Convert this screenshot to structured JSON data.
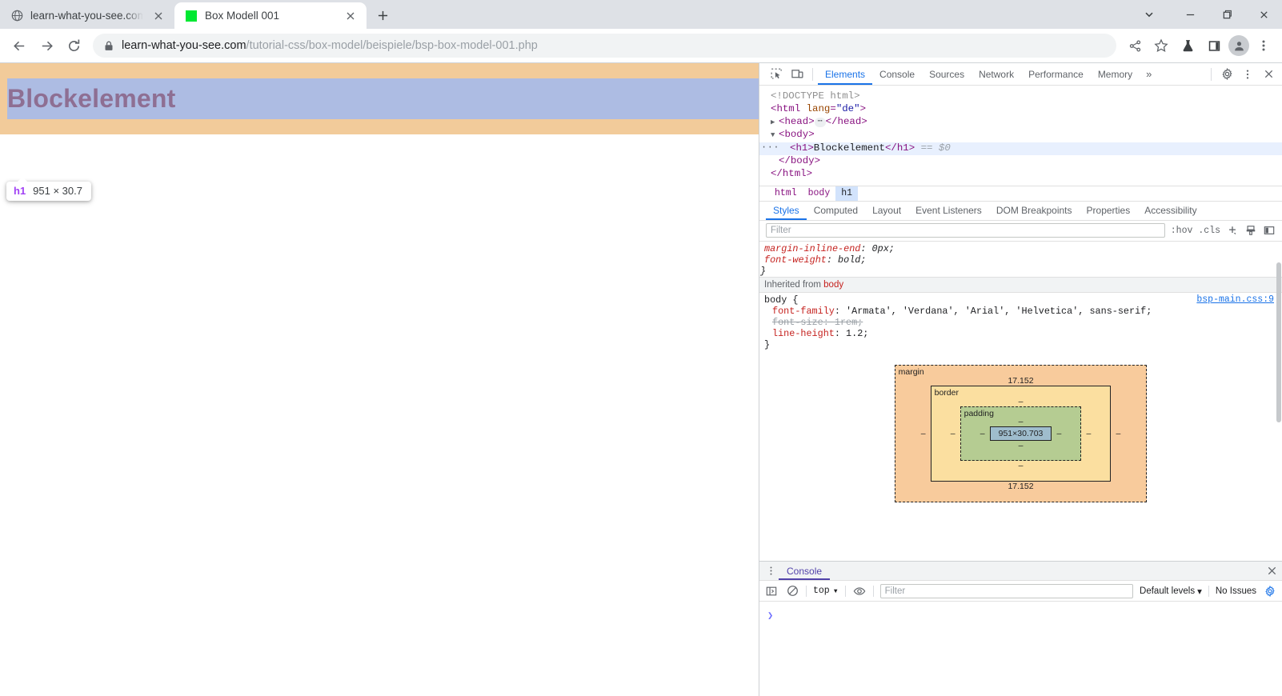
{
  "browser": {
    "tabs": [
      {
        "title": "learn-what-you-see.com -",
        "favicon": "globe-icon",
        "active": false
      },
      {
        "title": "Box Modell 001",
        "favicon": "green-square-icon",
        "active": true
      }
    ],
    "new_tab_label": "+",
    "window_controls": {
      "chevron": "⌄",
      "minimize": "—",
      "maximize": "❐",
      "close": "✕"
    },
    "nav": {
      "back": "←",
      "forward": "→",
      "reload": "⟳"
    },
    "omnibox": {
      "lock_icon": "lock-icon",
      "host": "learn-what-you-see.com",
      "path": "/tutorial-css/box-model/beispiele/bsp-box-model-001.php"
    },
    "toolbar_right": [
      "share-icon",
      "bookmark-star-icon",
      "flask-icon",
      "side-panel-icon",
      "profile-avatar-icon"
    ]
  },
  "page": {
    "heading": "Blockelement",
    "margin_color": "#f2cb9a",
    "heading_bg": "#adbce3",
    "heading_color": "#8e6f93",
    "tooltip": {
      "tag": "h1",
      "dimensions": "951 × 30.7"
    }
  },
  "devtools": {
    "toolbar_icons": [
      "inspect-element-icon",
      "device-toolbar-icon"
    ],
    "panels": [
      "Elements",
      "Console",
      "Sources",
      "Network",
      "Performance",
      "Memory"
    ],
    "panels_selected": "Elements",
    "more_panels_label": "»",
    "settings_icon": "gear-icon",
    "kebab_icon": "more-vertical-icon",
    "close_icon": "close-icon",
    "dom": {
      "lines": [
        {
          "indent": 0,
          "html_doctype": "<!DOCTYPE html>"
        },
        {
          "indent": 0,
          "text": "<html lang=\"de\">"
        },
        {
          "indent": 0,
          "text": "<head>…</head>"
        },
        {
          "indent": 0,
          "text": "<body>"
        },
        {
          "indent": 1,
          "text": "<h1>Blockelement</h1> == $0"
        },
        {
          "indent": 0,
          "text": "</body>"
        },
        {
          "indent": 0,
          "text": "</html>"
        }
      ],
      "doctype": "<!DOCTYPE html>",
      "html_open_tag": "html",
      "html_attr_name": "lang",
      "html_attr_value": "\"de\"",
      "head_tag": "head",
      "body_tag": "body",
      "h1_tag": "h1",
      "h1_text": "Blockelement",
      "selected_marker": "== $0",
      "close_body": "</body>",
      "close_html": "</html>",
      "gutter_dots": "···"
    },
    "breadcrumbs": [
      {
        "label": "html",
        "selected": false
      },
      {
        "label": "body",
        "selected": false
      },
      {
        "label": "h1",
        "selected": true
      }
    ],
    "sidebar_tabs": [
      "Styles",
      "Computed",
      "Layout",
      "Event Listeners",
      "DOM Breakpoints",
      "Properties",
      "Accessibility"
    ],
    "sidebar_tab_selected": "Styles",
    "filter": {
      "placeholder": "Filter",
      "value": ""
    },
    "filter_actions": {
      "hov": ":hov",
      "cls": ".cls",
      "plus": "+",
      "new_style_rule_icon": "new-style-rule-icon",
      "toggle_icon": "toggle-sidebar-icon"
    },
    "styles": {
      "partial_rule": [
        {
          "name": "margin-inline-end",
          "value": "0px;",
          "struck": false
        },
        {
          "name": "font-weight",
          "value": "bold;",
          "struck": false
        }
      ],
      "partial_close": "}",
      "inherited_label": "Inherited from",
      "inherited_from": "body",
      "rule_selector": "body {",
      "rule_source": "bsp-main.css:9",
      "rule_close": "}",
      "declarations": [
        {
          "name": "font-family",
          "value": "'Armata', 'Verdana', 'Arial', 'Helvetica', sans-serif;",
          "struck": false
        },
        {
          "name": "font-size",
          "value": "1rem;",
          "struck": true
        },
        {
          "name": "line-height",
          "value": "1.2;",
          "struck": false
        }
      ]
    },
    "box_model": {
      "margin_label": "margin",
      "border_label": "border",
      "padding_label": "padding",
      "content_size": "951×30.703",
      "margin_top": "17.152",
      "margin_bottom": "17.152",
      "margin_left": "–",
      "margin_right": "–",
      "border_top": "–",
      "border_bottom": "–",
      "border_left": "–",
      "border_right": "–",
      "padding_top": "–",
      "padding_bottom": "–",
      "padding_left": "–",
      "padding_right": "–",
      "colors": {
        "margin": "#f8cb9c",
        "border": "#fbdfa0",
        "padding": "#b5cc92",
        "content": "#9fbdcd"
      }
    },
    "drawer": {
      "kebab_icon": "more-vertical-icon",
      "tab_label": "Console",
      "close_icon": "close-icon",
      "toolbar": {
        "sidebar_icon": "console-sidebar-icon",
        "clear_icon": "clear-console-icon",
        "context": "top",
        "context_caret": "▾",
        "eye_icon": "live-expression-icon",
        "filter_placeholder": "Filter",
        "levels": "Default levels",
        "levels_caret": "▾",
        "issues": "No Issues",
        "settings_icon": "gear-icon"
      },
      "prompt": "❯"
    }
  }
}
